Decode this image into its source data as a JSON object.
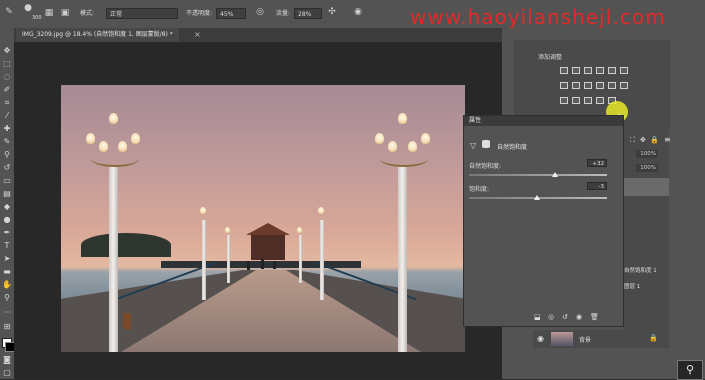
{
  "options_bar": {
    "brush_size": "300",
    "mode_label": "模式:",
    "mode_value": "正常",
    "opacity_label": "不透明度:",
    "opacity_value": "45%",
    "flow_label": "流量:",
    "flow_value": "28%"
  },
  "watermark": "www.haoyilanshejI.com",
  "document_tab": {
    "label": "IMG_3209.jpg @ 18.4% (自然饱和度 1, 图层蒙版/8) *"
  },
  "adjustments_panel": {
    "title": "添加调整"
  },
  "properties_panel": {
    "header": "属性",
    "adjustment_name": "自然饱和度",
    "sliders": [
      {
        "label": "自然饱和度:",
        "value": "+32",
        "fraction": 0.62
      },
      {
        "label": "饱和度:",
        "value": "-3",
        "fraction": 0.49
      }
    ]
  },
  "layers_panel": {
    "opacity_value": "100%",
    "fill_value": "100%",
    "layer_names": [
      "自然饱和度 1",
      "图层 1"
    ],
    "background_layer": "背景"
  },
  "colors": {
    "ui_panel": "#535353",
    "watermark": "#e02a2a",
    "canvas_bg": "#282828"
  }
}
